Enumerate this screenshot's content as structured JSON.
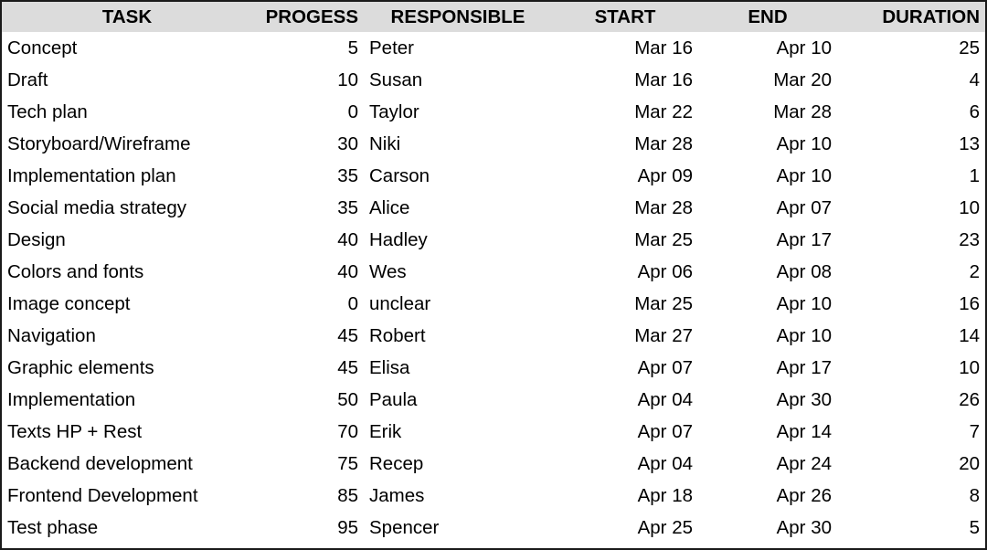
{
  "table": {
    "columns": [
      {
        "key": "task",
        "label": "TASK",
        "align": "center"
      },
      {
        "key": "progress",
        "label": "PROGESS",
        "align": "right"
      },
      {
        "key": "responsible",
        "label": "RESPONSIBLE",
        "align": "center"
      },
      {
        "key": "start",
        "label": "START",
        "align": "center"
      },
      {
        "key": "end",
        "label": "END",
        "align": "center"
      },
      {
        "key": "duration",
        "label": "DURATION",
        "align": "right"
      }
    ],
    "rows": [
      {
        "task": "Concept",
        "progress": "5",
        "responsible": "Peter",
        "start": "Mar 16",
        "end": "Apr 10",
        "duration": "25"
      },
      {
        "task": "Draft",
        "progress": "10",
        "responsible": "Susan",
        "start": "Mar 16",
        "end": "Mar 20",
        "duration": "4"
      },
      {
        "task": "Tech plan",
        "progress": "0",
        "responsible": "Taylor",
        "start": "Mar 22",
        "end": "Mar 28",
        "duration": "6"
      },
      {
        "task": "Storyboard/Wireframe",
        "progress": "30",
        "responsible": "Niki",
        "start": "Mar 28",
        "end": "Apr 10",
        "duration": "13"
      },
      {
        "task": "Implementation plan",
        "progress": "35",
        "responsible": "Carson",
        "start": "Apr 09",
        "end": "Apr 10",
        "duration": "1"
      },
      {
        "task": "Social media strategy",
        "progress": "35",
        "responsible": "Alice",
        "start": "Mar 28",
        "end": "Apr 07",
        "duration": "10"
      },
      {
        "task": "Design",
        "progress": "40",
        "responsible": "Hadley",
        "start": "Mar 25",
        "end": "Apr 17",
        "duration": "23"
      },
      {
        "task": "Colors and fonts",
        "progress": "40",
        "responsible": "Wes",
        "start": "Apr 06",
        "end": "Apr 08",
        "duration": "2"
      },
      {
        "task": "Image concept",
        "progress": "0",
        "responsible": "unclear",
        "start": "Mar 25",
        "end": "Apr 10",
        "duration": "16"
      },
      {
        "task": "Navigation",
        "progress": "45",
        "responsible": "Robert",
        "start": "Mar 27",
        "end": "Apr 10",
        "duration": "14"
      },
      {
        "task": "Graphic elements",
        "progress": "45",
        "responsible": "Elisa",
        "start": "Apr 07",
        "end": "Apr 17",
        "duration": "10"
      },
      {
        "task": "Implementation",
        "progress": "50",
        "responsible": "Paula",
        "start": "Apr 04",
        "end": "Apr 30",
        "duration": "26"
      },
      {
        "task": "Texts HP + Rest",
        "progress": "70",
        "responsible": "Erik",
        "start": "Apr 07",
        "end": "Apr 14",
        "duration": "7"
      },
      {
        "task": "Backend development",
        "progress": "75",
        "responsible": "Recep",
        "start": "Apr 04",
        "end": "Apr 24",
        "duration": "20"
      },
      {
        "task": "Frontend Development",
        "progress": "85",
        "responsible": "James",
        "start": "Apr 18",
        "end": "Apr 26",
        "duration": "8"
      },
      {
        "task": "Test phase",
        "progress": "95",
        "responsible": "Spencer",
        "start": "Apr 25",
        "end": "Apr 30",
        "duration": "5"
      }
    ]
  },
  "colors": {
    "header_background": "#dcdcdc",
    "body_background": "#ffffff",
    "text": "#000000",
    "border": "#1a1a1a"
  },
  "chart_data": {
    "type": "table",
    "title": "",
    "categories": [
      "Concept",
      "Draft",
      "Tech plan",
      "Storyboard/Wireframe",
      "Implementation plan",
      "Social media strategy",
      "Design",
      "Colors and fonts",
      "Image concept",
      "Navigation",
      "Graphic elements",
      "Implementation",
      "Texts HP + Rest",
      "Backend development",
      "Frontend Development",
      "Test phase"
    ],
    "series": [
      {
        "name": "PROGESS",
        "values": [
          5,
          10,
          0,
          30,
          35,
          35,
          40,
          40,
          0,
          45,
          45,
          50,
          70,
          75,
          85,
          95
        ]
      },
      {
        "name": "DURATION",
        "values": [
          25,
          4,
          6,
          13,
          1,
          10,
          23,
          2,
          16,
          14,
          10,
          26,
          7,
          20,
          8,
          5
        ]
      }
    ],
    "start_dates": [
      "Mar 16",
      "Mar 16",
      "Mar 22",
      "Mar 28",
      "Apr 09",
      "Mar 28",
      "Mar 25",
      "Apr 06",
      "Mar 25",
      "Mar 27",
      "Apr 07",
      "Apr 04",
      "Apr 07",
      "Apr 04",
      "Apr 18",
      "Apr 25"
    ],
    "end_dates": [
      "Apr 10",
      "Mar 20",
      "Mar 28",
      "Apr 10",
      "Apr 10",
      "Apr 07",
      "Apr 17",
      "Apr 08",
      "Apr 10",
      "Apr 10",
      "Apr 17",
      "Apr 30",
      "Apr 14",
      "Apr 24",
      "Apr 26",
      "Apr 30"
    ],
    "responsible": [
      "Peter",
      "Susan",
      "Taylor",
      "Niki",
      "Carson",
      "Alice",
      "Hadley",
      "Wes",
      "unclear",
      "Robert",
      "Elisa",
      "Paula",
      "Erik",
      "Recep",
      "James",
      "Spencer"
    ],
    "xlabel": "",
    "ylabel": "",
    "grid": false,
    "legend": "none"
  }
}
